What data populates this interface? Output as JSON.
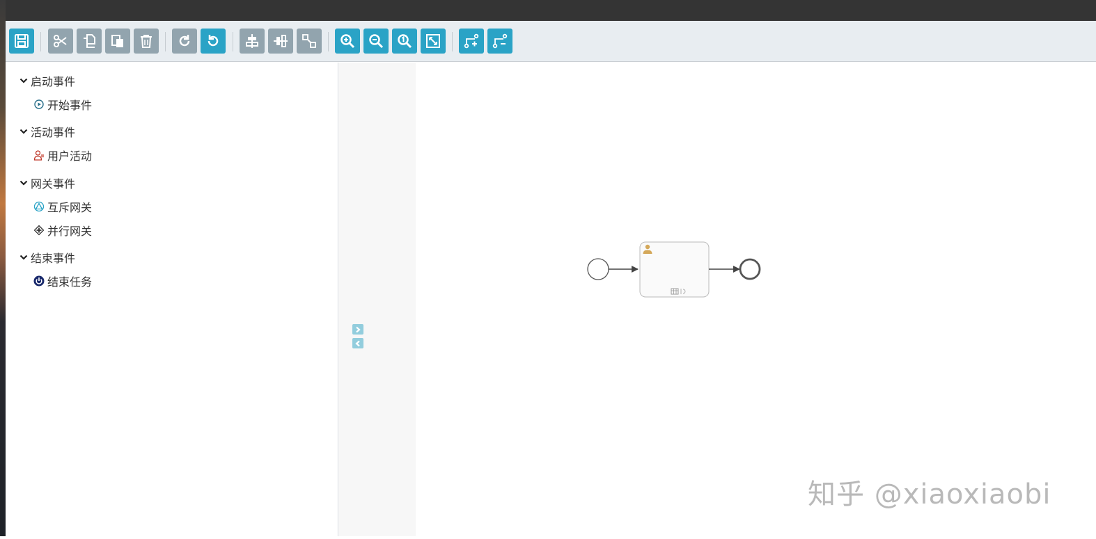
{
  "toolbar": {
    "buttons": [
      {
        "icon": "save-icon",
        "style": "primary"
      },
      {
        "icon": "cut-icon",
        "style": "muted"
      },
      {
        "icon": "copy-icon",
        "style": "muted"
      },
      {
        "icon": "paste-icon",
        "style": "muted"
      },
      {
        "icon": "delete-icon",
        "style": "muted"
      },
      {
        "icon": "redo-icon",
        "style": "muted"
      },
      {
        "icon": "undo-icon",
        "style": "primary"
      },
      {
        "icon": "align-vertical-icon",
        "style": "muted"
      },
      {
        "icon": "align-horizontal-icon",
        "style": "muted"
      },
      {
        "icon": "same-size-icon",
        "style": "muted"
      },
      {
        "icon": "zoom-in-icon",
        "style": "primary"
      },
      {
        "icon": "zoom-out-icon",
        "style": "primary"
      },
      {
        "icon": "zoom-actual-icon",
        "style": "primary"
      },
      {
        "icon": "zoom-fit-icon",
        "style": "primary"
      },
      {
        "icon": "add-bendpoint-icon",
        "style": "primary"
      },
      {
        "icon": "remove-bendpoint-icon",
        "style": "primary"
      }
    ]
  },
  "palette": {
    "groups": [
      {
        "label": "启动事件",
        "items": [
          {
            "label": "开始事件",
            "icon": "start-event-icon"
          }
        ]
      },
      {
        "label": "活动事件",
        "items": [
          {
            "label": "用户活动",
            "icon": "user-task-icon"
          }
        ]
      },
      {
        "label": "网关事件",
        "items": [
          {
            "label": "互斥网关",
            "icon": "exclusive-gateway-icon"
          },
          {
            "label": "并行网关",
            "icon": "parallel-gateway-icon"
          }
        ]
      },
      {
        "label": "结束事件",
        "items": [
          {
            "label": "结束任务",
            "icon": "end-event-icon"
          }
        ]
      }
    ]
  },
  "colors": {
    "primary": "#2aa3c6",
    "muted": "#92a4ae",
    "toolbar_bg": "#e8edf1",
    "top_bar": "#343434"
  },
  "watermark": "知乎 @xiaoxiaobi"
}
